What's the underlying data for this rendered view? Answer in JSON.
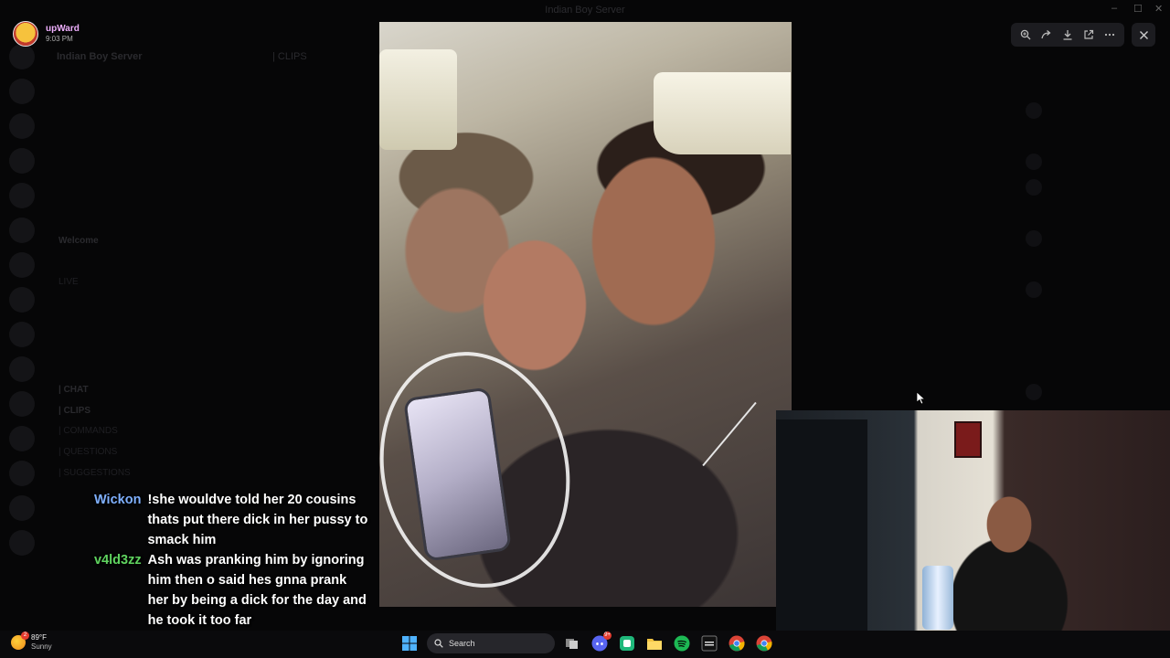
{
  "window": {
    "title": "Indian Boy Server"
  },
  "background": {
    "server_name": "Indian Boy Server",
    "channel_header": "| CLIPS",
    "channels": [
      {
        "name": "Welcome"
      },
      {
        "name": "LIVE"
      },
      {
        "name": "| CHAT"
      },
      {
        "name": "| CLIPS"
      },
      {
        "name": "| COMMANDS"
      },
      {
        "name": "| QUESTIONS"
      },
      {
        "name": "| SUGGESTIONS"
      }
    ]
  },
  "viewer": {
    "uploader_name": "upWard",
    "uploader_time": "9:03 PM",
    "toolbar_icons": [
      "zoom-in-icon",
      "forward-icon",
      "download-icon",
      "open-external-icon",
      "more-icon"
    ],
    "close_icon": "close-icon"
  },
  "chat": {
    "messages": [
      {
        "user": "Wickon",
        "color": "#7fb0ff",
        "text": "!she wouldve told her 20 cousins thats put there dick in her pussy to smack him"
      },
      {
        "user": "v4ld3zz",
        "color": "#5fd35f",
        "text": "Ash was pranking him by ignoring him then o said hes gnna prank her by being a dick for the day and he took it too far"
      }
    ]
  },
  "taskbar": {
    "weather": {
      "temp": "89°F",
      "condition": "Sunny",
      "badge": "2"
    },
    "search_label": "Search",
    "discord_badge": "9+",
    "apps": [
      "windows-start-icon",
      "search-icon",
      "task-view-icon",
      "discord-icon",
      "app-icon",
      "file-explorer-icon",
      "spotify-icon",
      "cod-icon",
      "chrome-icon",
      "chrome-icon"
    ]
  }
}
